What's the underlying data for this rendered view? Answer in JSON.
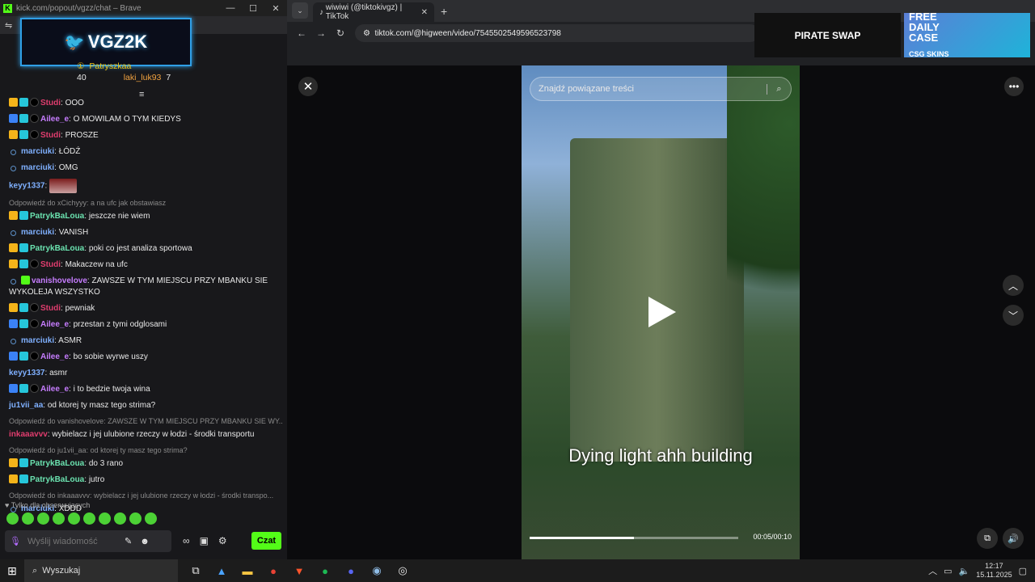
{
  "left_window": {
    "title": "kick.com/popout/vgzz/chat – Brave",
    "overlay_text": "VGZ2K",
    "leaderboard": [
      {
        "name": "Patryszkaa",
        "value": "40"
      },
      {
        "name": "laki_luk93",
        "value": "7"
      }
    ],
    "messages": [
      {
        "badges": [
          "crown",
          "sub",
          "dark"
        ],
        "user": "Studi",
        "color": "#e03d6e",
        "text": "OOO"
      },
      {
        "badges": [
          "blue",
          "sub",
          "dark"
        ],
        "user": "Ailee_e",
        "color": "#c77dff",
        "text": "O MOWILAM O TYM KIEDYS"
      },
      {
        "badges": [
          "crown",
          "sub",
          "dark"
        ],
        "user": "Studi",
        "color": "#e03d6e",
        "text": "PROSZE"
      },
      {
        "badges": [
          "ring"
        ],
        "user": "marciuki",
        "color": "#7fb0ff",
        "text": "ŁÓDŹ"
      },
      {
        "badges": [
          "ring"
        ],
        "user": "marciuki",
        "color": "#7fb0ff",
        "text": "OMG"
      },
      {
        "badges": [],
        "user": "keyy1337",
        "color": "#7fb0ff",
        "text": "",
        "emote": true
      },
      {
        "reply": "Odpowiedź do xCichyyy: a na ufc jak obstawiasz"
      },
      {
        "badges": [
          "crown",
          "sub"
        ],
        "user": "PatrykBaLoua",
        "color": "#6be3b0",
        "text": "jeszcze nie wiem"
      },
      {
        "badges": [
          "ring"
        ],
        "user": "marciuki",
        "color": "#7fb0ff",
        "text": "VANISH"
      },
      {
        "badges": [
          "crown",
          "sub"
        ],
        "user": "PatrykBaLoua",
        "color": "#6be3b0",
        "text": "poki co jest analiza sportowa"
      },
      {
        "badges": [
          "crown",
          "sub",
          "dark"
        ],
        "user": "Studi",
        "color": "#e03d6e",
        "text": "Makaczew na ufc"
      },
      {
        "badges": [
          "ring",
          "green"
        ],
        "user": "vanishovelove",
        "color": "#c77dff",
        "text": "ZAWSZE W TYM MIEJSCU PRZY MBANKU SIE WYKOLEJA WSZYSTKO"
      },
      {
        "badges": [
          "crown",
          "sub",
          "dark"
        ],
        "user": "Studi",
        "color": "#e03d6e",
        "text": "pewniak"
      },
      {
        "badges": [
          "blue",
          "sub",
          "dark"
        ],
        "user": "Ailee_e",
        "color": "#c77dff",
        "text": "przestan z tymi odglosami"
      },
      {
        "badges": [
          "ring"
        ],
        "user": "marciuki",
        "color": "#7fb0ff",
        "text": "ASMR"
      },
      {
        "badges": [
          "blue",
          "sub",
          "dark"
        ],
        "user": "Ailee_e",
        "color": "#c77dff",
        "text": "bo sobie wyrwe uszy"
      },
      {
        "badges": [],
        "user": "keyy1337",
        "color": "#7fb0ff",
        "text": "asmr"
      },
      {
        "badges": [
          "blue",
          "sub",
          "dark"
        ],
        "user": "Ailee_e",
        "color": "#c77dff",
        "text": "i to bedzie twoja wina"
      },
      {
        "badges": [],
        "user": "ju1vii_aa",
        "color": "#7fb0ff",
        "text": "od ktorej ty masz tego strima?"
      },
      {
        "reply": "Odpowiedź do vanishovelove: ZAWSZE W TYM MIEJSCU PRZY MBANKU SIE WY..."
      },
      {
        "badges": [],
        "user": "inkaaavvv",
        "color": "#e03d6e",
        "text": "wybielacz i jej ulubione rzeczy w łodzi - środki transportu"
      },
      {
        "reply": "Odpowiedź do ju1vii_aa: od ktorej ty masz tego strima?"
      },
      {
        "badges": [
          "crown",
          "sub"
        ],
        "user": "PatrykBaLoua",
        "color": "#6be3b0",
        "text": "do 3 rano"
      },
      {
        "badges": [
          "crown",
          "sub"
        ],
        "user": "PatrykBaLoua",
        "color": "#6be3b0",
        "text": "jutro"
      },
      {
        "reply": "Odpowiedź do inkaaavvv: wybielacz i jej ulubione rzeczy w łodzi - środki transpo..."
      },
      {
        "badges": [
          "ring"
        ],
        "user": "marciuki",
        "color": "#7fb0ff",
        "text": "XDDD"
      }
    ],
    "followers_only": "Tylko dla obserwujących",
    "input_placeholder": "Wyślij wiadomość",
    "send_label": "Czat"
  },
  "browser": {
    "tab_title": "wiwiwi (@tiktokivgz) | TikTok",
    "url": "tiktok.com/@higween/video/7545502549596523798",
    "ad1": "PIRATE SWAP",
    "ad2_line1": "FREE",
    "ad2_line2": "DAILY",
    "ad2_line3": "CASE",
    "ad2_brand": "CSG SKINS",
    "search_placeholder": "Znajdź powiązane treści",
    "caption": "Dying light ahh building",
    "time": "00:05/00:10",
    "progress": 0.5
  },
  "taskbar": {
    "search": "Wyszukaj",
    "time": "12:17",
    "date": "15.11.2025"
  }
}
